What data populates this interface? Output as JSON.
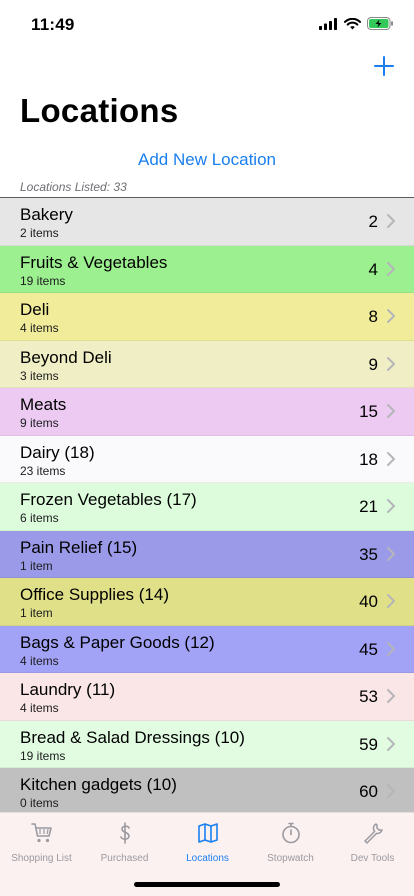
{
  "status": {
    "time": "11:49"
  },
  "header": {
    "title": "Locations",
    "add_location_label": "Add New Location",
    "count_label": "Locations Listed: 33"
  },
  "rows": [
    {
      "name": "Bakery",
      "sub": "2 items",
      "num": "2",
      "color": "#e6e6e6"
    },
    {
      "name": "Fruits & Vegetables",
      "sub": "19 items",
      "num": "4",
      "color": "#9cf090"
    },
    {
      "name": "Deli",
      "sub": "4 items",
      "num": "8",
      "color": "#f0ec9a"
    },
    {
      "name": "Beyond Deli",
      "sub": "3 items",
      "num": "9",
      "color": "#f0eec4"
    },
    {
      "name": "Meats",
      "sub": "9 items",
      "num": "15",
      "color": "#eccaf2"
    },
    {
      "name": "Dairy (18)",
      "sub": "23 items",
      "num": "18",
      "color": "#fafafd"
    },
    {
      "name": "Frozen Vegetables (17)",
      "sub": "6 items",
      "num": "21",
      "color": "#dcfcdc"
    },
    {
      "name": "Pain Relief (15)",
      "sub": "1 item",
      "num": "35",
      "color": "#9a9ae8"
    },
    {
      "name": "Office Supplies (14)",
      "sub": "1 item",
      "num": "40",
      "color": "#e0e088"
    },
    {
      "name": "Bags & Paper Goods (12)",
      "sub": "4 items",
      "num": "45",
      "color": "#a2a2f6"
    },
    {
      "name": "Laundry (11)",
      "sub": "4 items",
      "num": "53",
      "color": "#fae6e6"
    },
    {
      "name": "Bread & Salad Dressings (10)",
      "sub": "19 items",
      "num": "59",
      "color": "#e2fce2"
    },
    {
      "name": "Kitchen gadgets (10)",
      "sub": "0 items",
      "num": "60",
      "color": "#c0c0c0"
    }
  ],
  "tabs": [
    {
      "label": "Shopping List",
      "icon": "cart-icon"
    },
    {
      "label": "Purchased",
      "icon": "dollar-icon"
    },
    {
      "label": "Locations",
      "icon": "map-icon",
      "active": true
    },
    {
      "label": "Stopwatch",
      "icon": "stopwatch-icon"
    },
    {
      "label": "Dev Tools",
      "icon": "wrench-icon"
    }
  ],
  "colors": {
    "accent": "#1a7ff0",
    "tab_inactive": "#9a9aa0"
  }
}
